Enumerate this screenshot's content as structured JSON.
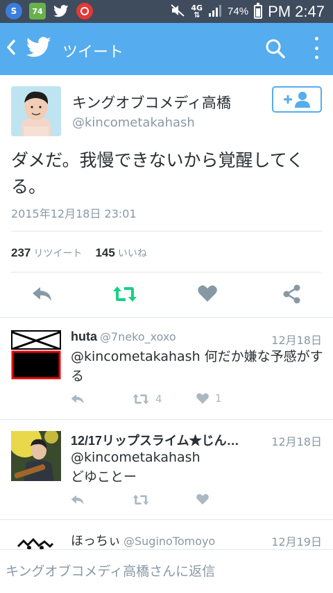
{
  "status_bar": {
    "app_badge": "74",
    "network": "4G",
    "battery": "74%",
    "time": "PM 2:47"
  },
  "app_bar": {
    "title": "ツイート"
  },
  "tweet": {
    "author_name": "キングオブコメディ高橋",
    "author_handle": "@kincometakahash",
    "text": "ダメだ。我慢できないから覚醒してくる。",
    "date": "2015年12月18日 23:01",
    "retweets": "237",
    "retweets_label": "リツイート",
    "likes": "145",
    "likes_label": "いいね"
  },
  "replies": [
    {
      "name": "huta",
      "handle": "@7neko_xoxo",
      "date": "12月18日",
      "text": "@kincometakahash 何だか嫌な予感がする",
      "retweets": "4",
      "likes": "1"
    },
    {
      "name": "12/17リップスライム★じん…",
      "handle": "",
      "date": "12月18日",
      "text": "@kincometakahash\nどゆことー",
      "retweets": "",
      "likes": ""
    },
    {
      "name": "ほっちぃ",
      "handle": "@SuginoTomoyo",
      "date": "12月19日",
      "text": "",
      "retweets": "",
      "likes": ""
    }
  ],
  "reply_bar": {
    "placeholder": "キングオブコメディ高橋さんに返信"
  },
  "colors": {
    "twitter_blue": "#55acee",
    "retweet_green": "#19cf86",
    "status_bar": "#3f4c5e"
  }
}
